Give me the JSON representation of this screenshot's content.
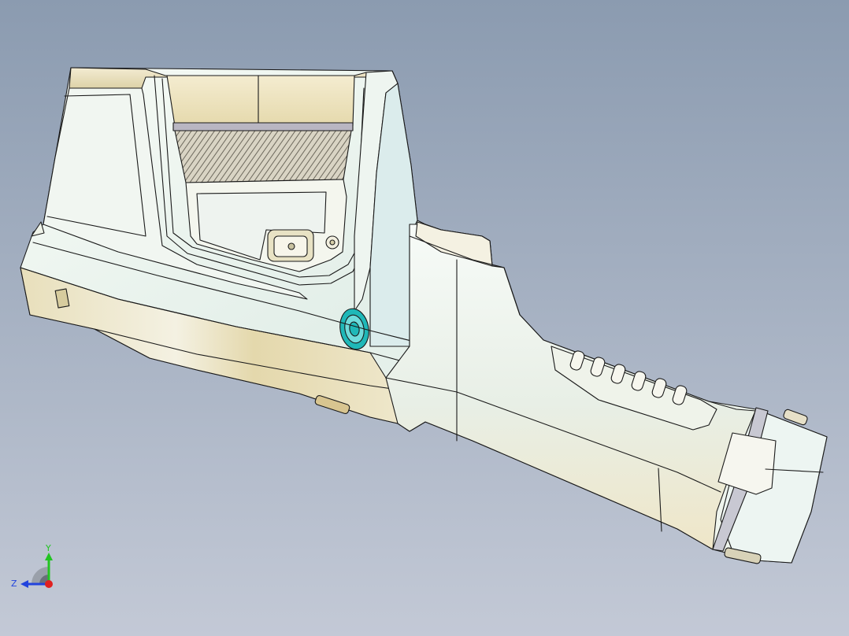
{
  "viewport": {
    "background_top": "#8b9bb0",
    "background_bottom": "#c3c9d6"
  },
  "model": {
    "body_color": "#eaf2ec",
    "highlight_color": "#ffffff",
    "cream_color": "#e6dcb3",
    "edge_color": "#1a1a1a",
    "lens_grip_color": "#b7b2a2",
    "accent_ring_color": "#1fb8b8",
    "band_color": "#c8c8d2"
  },
  "triad": {
    "y_label": "Y",
    "z_label": "Z",
    "y_color": "#22c422",
    "z_color": "#2244dd",
    "x_color": "#e02020"
  }
}
